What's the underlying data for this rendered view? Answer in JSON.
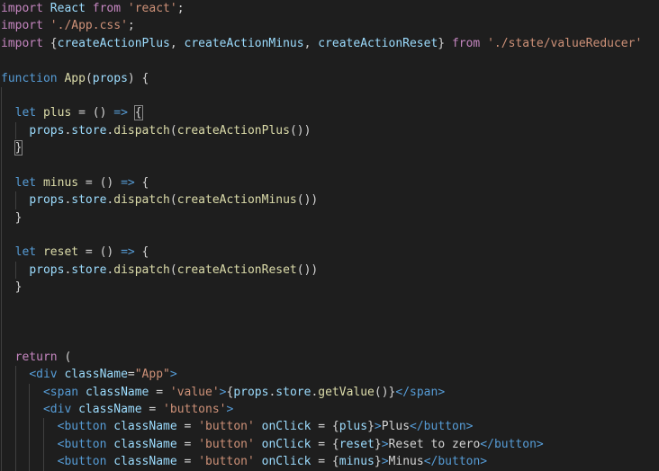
{
  "editor": {
    "lines": [
      [
        {
          "t": "import",
          "c": "kw"
        },
        {
          "t": " React ",
          "c": "var"
        },
        {
          "t": "from",
          "c": "kw"
        },
        {
          "t": " ",
          "c": "plain"
        },
        {
          "t": "'react'",
          "c": "str"
        },
        {
          "t": ";",
          "c": "plain"
        }
      ],
      [
        {
          "t": "import",
          "c": "kw"
        },
        {
          "t": " ",
          "c": "plain"
        },
        {
          "t": "'./App.css'",
          "c": "str"
        },
        {
          "t": ";",
          "c": "plain"
        }
      ],
      [
        {
          "t": "import",
          "c": "kw"
        },
        {
          "t": " {",
          "c": "plain"
        },
        {
          "t": "createActionPlus",
          "c": "var"
        },
        {
          "t": ", ",
          "c": "plain"
        },
        {
          "t": "createActionMinus",
          "c": "var"
        },
        {
          "t": ", ",
          "c": "plain"
        },
        {
          "t": "createActionReset",
          "c": "var"
        },
        {
          "t": "} ",
          "c": "plain"
        },
        {
          "t": "from",
          "c": "kw"
        },
        {
          "t": " ",
          "c": "plain"
        },
        {
          "t": "'./state/valueReducer'",
          "c": "str"
        }
      ],
      [],
      [
        {
          "t": "function",
          "c": "kw2"
        },
        {
          "t": " ",
          "c": "plain"
        },
        {
          "t": "App",
          "c": "fn"
        },
        {
          "t": "(",
          "c": "plain"
        },
        {
          "t": "props",
          "c": "var"
        },
        {
          "t": ") {",
          "c": "plain"
        }
      ],
      [],
      [
        {
          "t": "  ",
          "c": "plain"
        },
        {
          "t": "let",
          "c": "kw2"
        },
        {
          "t": " ",
          "c": "plain"
        },
        {
          "t": "plus",
          "c": "fn"
        },
        {
          "t": " = () ",
          "c": "plain"
        },
        {
          "t": "=>",
          "c": "kw2"
        },
        {
          "t": " ",
          "c": "plain"
        },
        {
          "t": "{",
          "c": "brace-match"
        }
      ],
      [
        {
          "t": "    ",
          "c": "plain"
        },
        {
          "t": "props",
          "c": "var"
        },
        {
          "t": ".",
          "c": "plain"
        },
        {
          "t": "store",
          "c": "var"
        },
        {
          "t": ".",
          "c": "plain"
        },
        {
          "t": "dispatch",
          "c": "fn"
        },
        {
          "t": "(",
          "c": "plain"
        },
        {
          "t": "createActionPlus",
          "c": "fn"
        },
        {
          "t": "())",
          "c": "plain"
        }
      ],
      [
        {
          "t": "  ",
          "c": "plain"
        },
        {
          "t": "}",
          "c": "brace-match"
        }
      ],
      [],
      [
        {
          "t": "  ",
          "c": "plain"
        },
        {
          "t": "let",
          "c": "kw2"
        },
        {
          "t": " ",
          "c": "plain"
        },
        {
          "t": "minus",
          "c": "fn"
        },
        {
          "t": " = () ",
          "c": "plain"
        },
        {
          "t": "=>",
          "c": "kw2"
        },
        {
          "t": " {",
          "c": "plain"
        }
      ],
      [
        {
          "t": "    ",
          "c": "plain"
        },
        {
          "t": "props",
          "c": "var"
        },
        {
          "t": ".",
          "c": "plain"
        },
        {
          "t": "store",
          "c": "var"
        },
        {
          "t": ".",
          "c": "plain"
        },
        {
          "t": "dispatch",
          "c": "fn"
        },
        {
          "t": "(",
          "c": "plain"
        },
        {
          "t": "createActionMinus",
          "c": "fn"
        },
        {
          "t": "())",
          "c": "plain"
        }
      ],
      [
        {
          "t": "  }",
          "c": "plain"
        }
      ],
      [],
      [
        {
          "t": "  ",
          "c": "plain"
        },
        {
          "t": "let",
          "c": "kw2"
        },
        {
          "t": " ",
          "c": "plain"
        },
        {
          "t": "reset",
          "c": "fn"
        },
        {
          "t": " = () ",
          "c": "plain"
        },
        {
          "t": "=>",
          "c": "kw2"
        },
        {
          "t": " {",
          "c": "plain"
        }
      ],
      [
        {
          "t": "    ",
          "c": "plain"
        },
        {
          "t": "props",
          "c": "var"
        },
        {
          "t": ".",
          "c": "plain"
        },
        {
          "t": "store",
          "c": "var"
        },
        {
          "t": ".",
          "c": "plain"
        },
        {
          "t": "dispatch",
          "c": "fn"
        },
        {
          "t": "(",
          "c": "plain"
        },
        {
          "t": "createActionReset",
          "c": "fn"
        },
        {
          "t": "())",
          "c": "plain"
        }
      ],
      [
        {
          "t": "  }",
          "c": "plain"
        }
      ],
      [],
      [],
      [],
      [
        {
          "t": "  ",
          "c": "plain"
        },
        {
          "t": "return",
          "c": "kw"
        },
        {
          "t": " (",
          "c": "plain"
        }
      ],
      [
        {
          "t": "    ",
          "c": "plain"
        },
        {
          "t": "<div",
          "c": "tag"
        },
        {
          "t": " ",
          "c": "plain"
        },
        {
          "t": "className",
          "c": "attr"
        },
        {
          "t": "=",
          "c": "plain"
        },
        {
          "t": "\"App\"",
          "c": "str"
        },
        {
          "t": ">",
          "c": "tag"
        }
      ],
      [
        {
          "t": "      ",
          "c": "plain"
        },
        {
          "t": "<span",
          "c": "tag"
        },
        {
          "t": " ",
          "c": "plain"
        },
        {
          "t": "className",
          "c": "attr"
        },
        {
          "t": " = ",
          "c": "plain"
        },
        {
          "t": "'value'",
          "c": "str"
        },
        {
          "t": ">",
          "c": "tag"
        },
        {
          "t": "{",
          "c": "plain"
        },
        {
          "t": "props",
          "c": "var"
        },
        {
          "t": ".",
          "c": "plain"
        },
        {
          "t": "store",
          "c": "var"
        },
        {
          "t": ".",
          "c": "plain"
        },
        {
          "t": "getValue",
          "c": "fn"
        },
        {
          "t": "()}",
          "c": "plain"
        },
        {
          "t": "</span>",
          "c": "tag"
        }
      ],
      [
        {
          "t": "      ",
          "c": "plain"
        },
        {
          "t": "<div",
          "c": "tag"
        },
        {
          "t": " ",
          "c": "plain"
        },
        {
          "t": "className",
          "c": "attr"
        },
        {
          "t": " = ",
          "c": "plain"
        },
        {
          "t": "'buttons'",
          "c": "str"
        },
        {
          "t": ">",
          "c": "tag"
        }
      ],
      [
        {
          "t": "        ",
          "c": "plain"
        },
        {
          "t": "<button",
          "c": "tag"
        },
        {
          "t": " ",
          "c": "plain"
        },
        {
          "t": "className",
          "c": "attr"
        },
        {
          "t": " = ",
          "c": "plain"
        },
        {
          "t": "'button'",
          "c": "str"
        },
        {
          "t": " ",
          "c": "plain"
        },
        {
          "t": "onClick",
          "c": "attr"
        },
        {
          "t": " = {",
          "c": "plain"
        },
        {
          "t": "plus",
          "c": "var"
        },
        {
          "t": "}",
          "c": "plain"
        },
        {
          "t": ">",
          "c": "tag"
        },
        {
          "t": "Plus",
          "c": "plain"
        },
        {
          "t": "</button>",
          "c": "tag"
        }
      ],
      [
        {
          "t": "        ",
          "c": "plain"
        },
        {
          "t": "<button",
          "c": "tag"
        },
        {
          "t": " ",
          "c": "plain"
        },
        {
          "t": "className",
          "c": "attr"
        },
        {
          "t": " = ",
          "c": "plain"
        },
        {
          "t": "'button'",
          "c": "str"
        },
        {
          "t": " ",
          "c": "plain"
        },
        {
          "t": "onClick",
          "c": "attr"
        },
        {
          "t": " = {",
          "c": "plain"
        },
        {
          "t": "reset",
          "c": "var"
        },
        {
          "t": "}",
          "c": "plain"
        },
        {
          "t": ">",
          "c": "tag"
        },
        {
          "t": "Reset to zero",
          "c": "plain"
        },
        {
          "t": "</button>",
          "c": "tag"
        }
      ],
      [
        {
          "t": "        ",
          "c": "plain"
        },
        {
          "t": "<button",
          "c": "tag"
        },
        {
          "t": " ",
          "c": "plain"
        },
        {
          "t": "className",
          "c": "attr"
        },
        {
          "t": " = ",
          "c": "plain"
        },
        {
          "t": "'button'",
          "c": "str"
        },
        {
          "t": " ",
          "c": "plain"
        },
        {
          "t": "onClick",
          "c": "attr"
        },
        {
          "t": " = {",
          "c": "plain"
        },
        {
          "t": "minus",
          "c": "var"
        },
        {
          "t": "}",
          "c": "plain"
        },
        {
          "t": ">",
          "c": "tag"
        },
        {
          "t": "Minus",
          "c": "plain"
        },
        {
          "t": "</button>",
          "c": "tag"
        }
      ]
    ],
    "colors": {
      "background": "#1e1e1e",
      "keyword_control": "#c586c0",
      "keyword": "#569cd6",
      "string": "#ce9178",
      "function": "#dcdcaa",
      "variable": "#9cdcfe",
      "text": "#d4d4d4"
    }
  }
}
